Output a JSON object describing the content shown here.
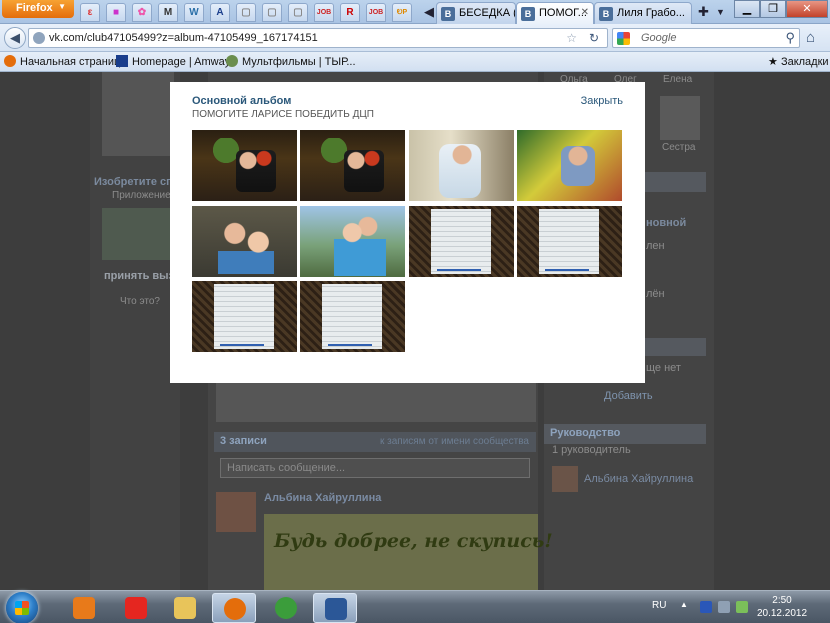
{
  "browser": {
    "menu_label": "Firefox",
    "menu_arrow": "▼",
    "app_tabs": [
      {
        "icon": "fire-icon",
        "glyph": "ε",
        "color": "#d33"
      },
      {
        "icon": "colors-icon",
        "glyph": "■",
        "color": "#c3c"
      },
      {
        "icon": "flower-icon",
        "glyph": "✿",
        "color": "#e5a"
      },
      {
        "icon": "film-icon",
        "glyph": "M",
        "color": "#333"
      },
      {
        "icon": "wordpress-icon",
        "glyph": "W",
        "color": "#2a6fa8"
      },
      {
        "icon": "letter-a-icon",
        "glyph": "A",
        "color": "#1a3e8c"
      },
      {
        "icon": "grid-icon",
        "glyph": "▢",
        "color": "#888"
      },
      {
        "icon": "grid-icon",
        "glyph": "▢",
        "color": "#888"
      },
      {
        "icon": "grid-icon",
        "glyph": "▢",
        "color": "#888"
      },
      {
        "icon": "job-icon",
        "glyph": "JOB",
        "color": "#c22"
      },
      {
        "icon": "letter-r-icon",
        "glyph": "R",
        "color": "#c00"
      },
      {
        "icon": "job-icon",
        "glyph": "JOB",
        "color": "#c22"
      },
      {
        "icon": "tag-icon",
        "glyph": "ᎧP",
        "color": "#d80"
      }
    ],
    "scroll_left": "◀",
    "tabs": [
      {
        "label": "БЕСЕДКА (Б...",
        "fav": "B"
      },
      {
        "label": "ПОМОГ...",
        "fav": "B",
        "active": true
      },
      {
        "label": "Лиля Грабо...",
        "fav": "B"
      }
    ],
    "tab_close": "✕",
    "new_tab": "✚",
    "list_tabs": "▼",
    "window_buttons": {
      "minimize": "▁",
      "restore": "❐",
      "close": "✕"
    },
    "back": "◀",
    "url": "vk.com/club47105499?z=album-47105499_167174151",
    "bookmark_star": "☆",
    "reload": "↻",
    "search_placeholder": "Google",
    "search_glyph": "⚲",
    "home": "⌂",
    "bookmarks": [
      {
        "label": "Начальная страница",
        "icon": "firefox-icon",
        "color": "#e46d0b"
      },
      {
        "label": "Homepage | Amway",
        "icon": "letter-a-icon",
        "color": "#1a3e8c"
      },
      {
        "label": "Мультфильмы | ТЫР...",
        "icon": "globe-icon",
        "color": "#6b8e4e"
      }
    ],
    "bookmarks_menu": "Закладки",
    "bookmarks_glyph": "★"
  },
  "background_page": {
    "left_items": [
      {
        "title": "Изобретите спос",
        "sub": "Приложение"
      },
      {
        "title": "принять вызов"
      },
      {
        "title": "Что это?"
      }
    ],
    "right_people": [
      "Ольга",
      "Олег",
      "Елена",
      "Сестра"
    ],
    "right_texts": [
      "новной",
      "лен",
      "лён",
      "ще нет"
    ],
    "add_label": "Добавить",
    "management_header": "Руководство",
    "managers_count": "1 руководитель",
    "manager_name": "Альбина Хайруллина",
    "posts_count": "3 записи",
    "posts_filter": "к записям от имени сообщества",
    "post_placeholder": "Написать сообщение...",
    "post_author": "Альбина Хайруллина",
    "banner_text": "Будь добрее, не скупись!"
  },
  "modal": {
    "title": "Основной альбом",
    "close_label": "Закрыть",
    "subtitle": "ПОМОГИТЕ ЛАРИСЕ ПОБЕДИТЬ ДЦП",
    "photos": [
      {
        "kind": "family"
      },
      {
        "kind": "family"
      },
      {
        "kind": "baby"
      },
      {
        "kind": "play"
      },
      {
        "kind": "mom"
      },
      {
        "kind": "outdoor"
      },
      {
        "kind": "doc"
      },
      {
        "kind": "doc"
      },
      {
        "kind": "doc"
      },
      {
        "kind": "doc"
      }
    ]
  },
  "taskbar": {
    "items": [
      {
        "icon": "media-player-icon",
        "color": "#e87a1a"
      },
      {
        "icon": "yandex-icon",
        "color": "#e52620"
      },
      {
        "icon": "folder-icon",
        "color": "#e8c45a"
      },
      {
        "icon": "firefox-icon",
        "color": "#e46d0b",
        "active": true
      },
      {
        "icon": "chrome-icon",
        "color": "#3b9d3b"
      },
      {
        "icon": "word-icon",
        "color": "#2b5797",
        "active": true
      }
    ],
    "language": "RU",
    "tray_up": "▲",
    "time": "2:50",
    "date": "20.12.2012"
  }
}
